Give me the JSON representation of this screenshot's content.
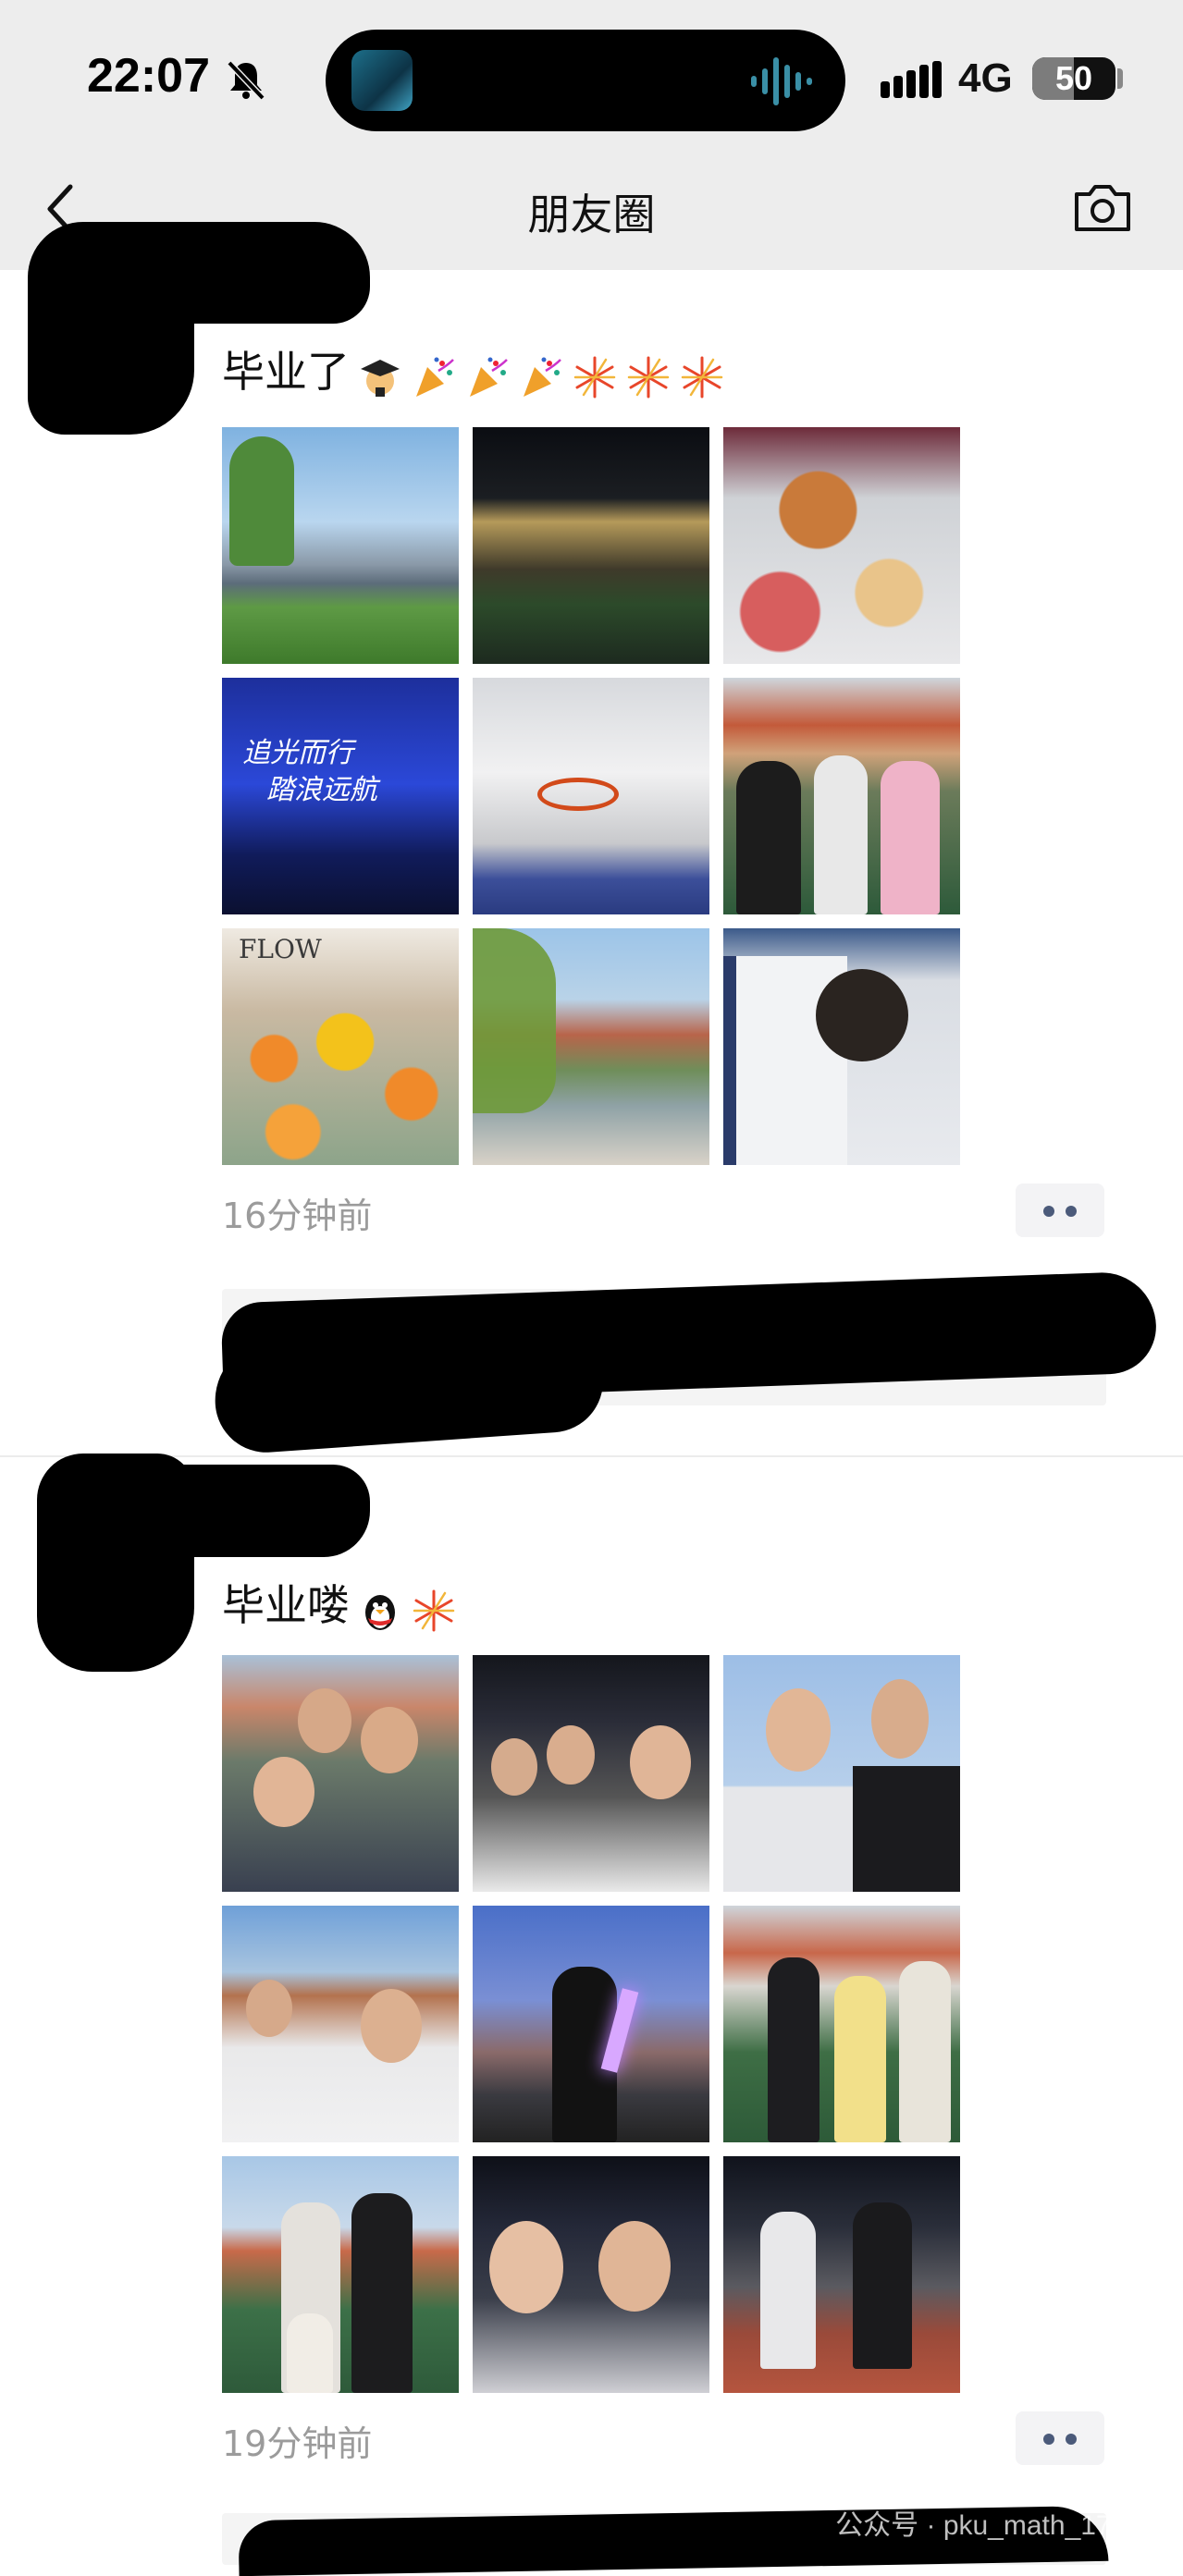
{
  "status_bar": {
    "time": "22:07",
    "network": "4G",
    "battery": "50",
    "battery_level": 0.5,
    "icons": [
      "bell-slash-icon",
      "signal-icon",
      "battery-icon"
    ]
  },
  "nav": {
    "title": "朋友圈",
    "back_icon": "chevron-left-icon",
    "camera_icon": "camera-icon"
  },
  "posts": [
    {
      "text": "毕业了",
      "emojis": [
        "graduate-emoji",
        "party-popper-emoji",
        "party-popper-emoji",
        "party-popper-emoji",
        "fireworks-emoji",
        "fireworks-emoji",
        "fireworks-emoji"
      ],
      "time": "16分钟前",
      "photos": [
        "campus-building-photo",
        "night-campus-photo",
        "hotpot-dinner-photo",
        "stage-performance-photo",
        "basketball-hoop-photo",
        "three-people-photo",
        "sunflower-bouquet-photo",
        "campus-willow-photo",
        "signing-shirt-photo"
      ]
    },
    {
      "text": "毕业喽",
      "emojis": [
        "penguin-emoji",
        "fireworks-emoji"
      ],
      "time": "19分钟前",
      "photos": [
        "group-selfie-photo",
        "night-group-selfie-photo",
        "thumbs-up-photo",
        "students-v-sign-photo",
        "glow-stick-photo",
        "three-on-field-photo",
        "family-photo",
        "night-selfie-photo",
        "pose-on-track-photo"
      ]
    }
  ],
  "stage_photo_text": [
    "追光而行",
    "踏浪远航"
  ],
  "bouquet_text": "FLOW",
  "watermark": "公众号 · pku_math_1701",
  "colors": {
    "topbar": "#ededed",
    "timestamp": "#9b9b9b",
    "more_dots": "#4b5a7a",
    "likes_bg": "#f4f4f4"
  }
}
